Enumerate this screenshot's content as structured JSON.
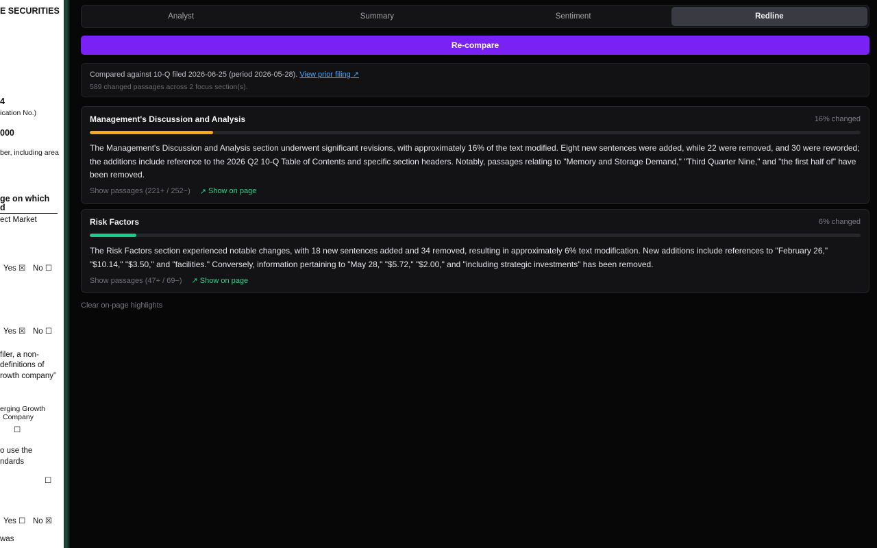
{
  "document_strip": {
    "lines": [
      {
        "text": "E SECURITIES",
        "bold": true
      },
      {
        "text": "4",
        "bold": true
      },
      {
        "text": "ication No.)",
        "bold": false
      },
      {
        "text": "000",
        "bold": true
      },
      {
        "text": "ber, including area",
        "bold": false
      },
      {
        "text": "ge on which",
        "bold": true
      },
      {
        "text": "d",
        "bold": true
      },
      {
        "text": "ect Market",
        "bold": false
      },
      {
        "text": "Yes ☒",
        "bold": false
      },
      {
        "text": "No ☐",
        "bold": false
      },
      {
        "text": "Yes ☒",
        "bold": false
      },
      {
        "text": "No ☐",
        "bold": false
      },
      {
        "text": "filer, a non-",
        "bold": false
      },
      {
        "text": "definitions of",
        "bold": false
      },
      {
        "text": "rowth company”",
        "bold": false
      },
      {
        "text": "erging Growth",
        "bold": false
      },
      {
        "text": "Company",
        "bold": false
      },
      {
        "text": "☐",
        "bold": false
      },
      {
        "text": "o use the",
        "bold": false
      },
      {
        "text": "ndards",
        "bold": false
      },
      {
        "text": "☐",
        "bold": false
      },
      {
        "text": "Yes ☐",
        "bold": false
      },
      {
        "text": "No ☒",
        "bold": false
      },
      {
        "text": "was",
        "bold": false
      }
    ]
  },
  "tabs": [
    {
      "label": "Analyst",
      "active": false
    },
    {
      "label": "Summary",
      "active": false
    },
    {
      "label": "Sentiment",
      "active": false
    },
    {
      "label": "Redline",
      "active": true
    }
  ],
  "recompare_label": "Re-compare",
  "comparison": {
    "text": "Compared against 10-Q filed 2026-06-25 (period 2026-05-28).",
    "link_label": "View prior filing ↗",
    "summary": "589 changed passages across 2 focus section(s)."
  },
  "sections": [
    {
      "title": "Management's Discussion and Analysis",
      "changed_label": "16% changed",
      "changed_fraction": 0.16,
      "bar_color": "#f5a623",
      "summary": "The Management's Discussion and Analysis section underwent significant revisions, with approximately 16% of the text modified. Eight new sentences were added, while 22 were removed, and 30 were reworded; the additions include reference to the 2026 Q2 10-Q Table of Contents and specific section headers. Notably, passages relating to \"Memory and Storage Demand,\" \"Third Quarter Nine,\" and \"the first half of\" have been removed.",
      "show_passages_label": "Show passages (221+ / 252−)",
      "show_on_page_label": "Show on page"
    },
    {
      "title": "Risk Factors",
      "changed_label": "6% changed",
      "changed_fraction": 0.06,
      "bar_color": "#1fc98b",
      "summary": "The Risk Factors section experienced notable changes, with 18 new sentences added and 34 removed, resulting in approximately 6% text modification. New additions include references to \"February 26,\" \"$10.14,\" \"$3.50,\" and \"facilities.\" Conversely, information pertaining to \"May 28,\" \"$5.72,\" \"$2.00,\" and \"including strategic investments\" has been removed.",
      "show_passages_label": "Show passages (47+ / 69−)",
      "show_on_page_label": "Show on page"
    }
  ],
  "clear_highlights_label": "Clear on-page highlights",
  "colors": {
    "accent": "#7a22f5",
    "link": "#4aa8ff",
    "show_on_page": "#2fd28a"
  }
}
